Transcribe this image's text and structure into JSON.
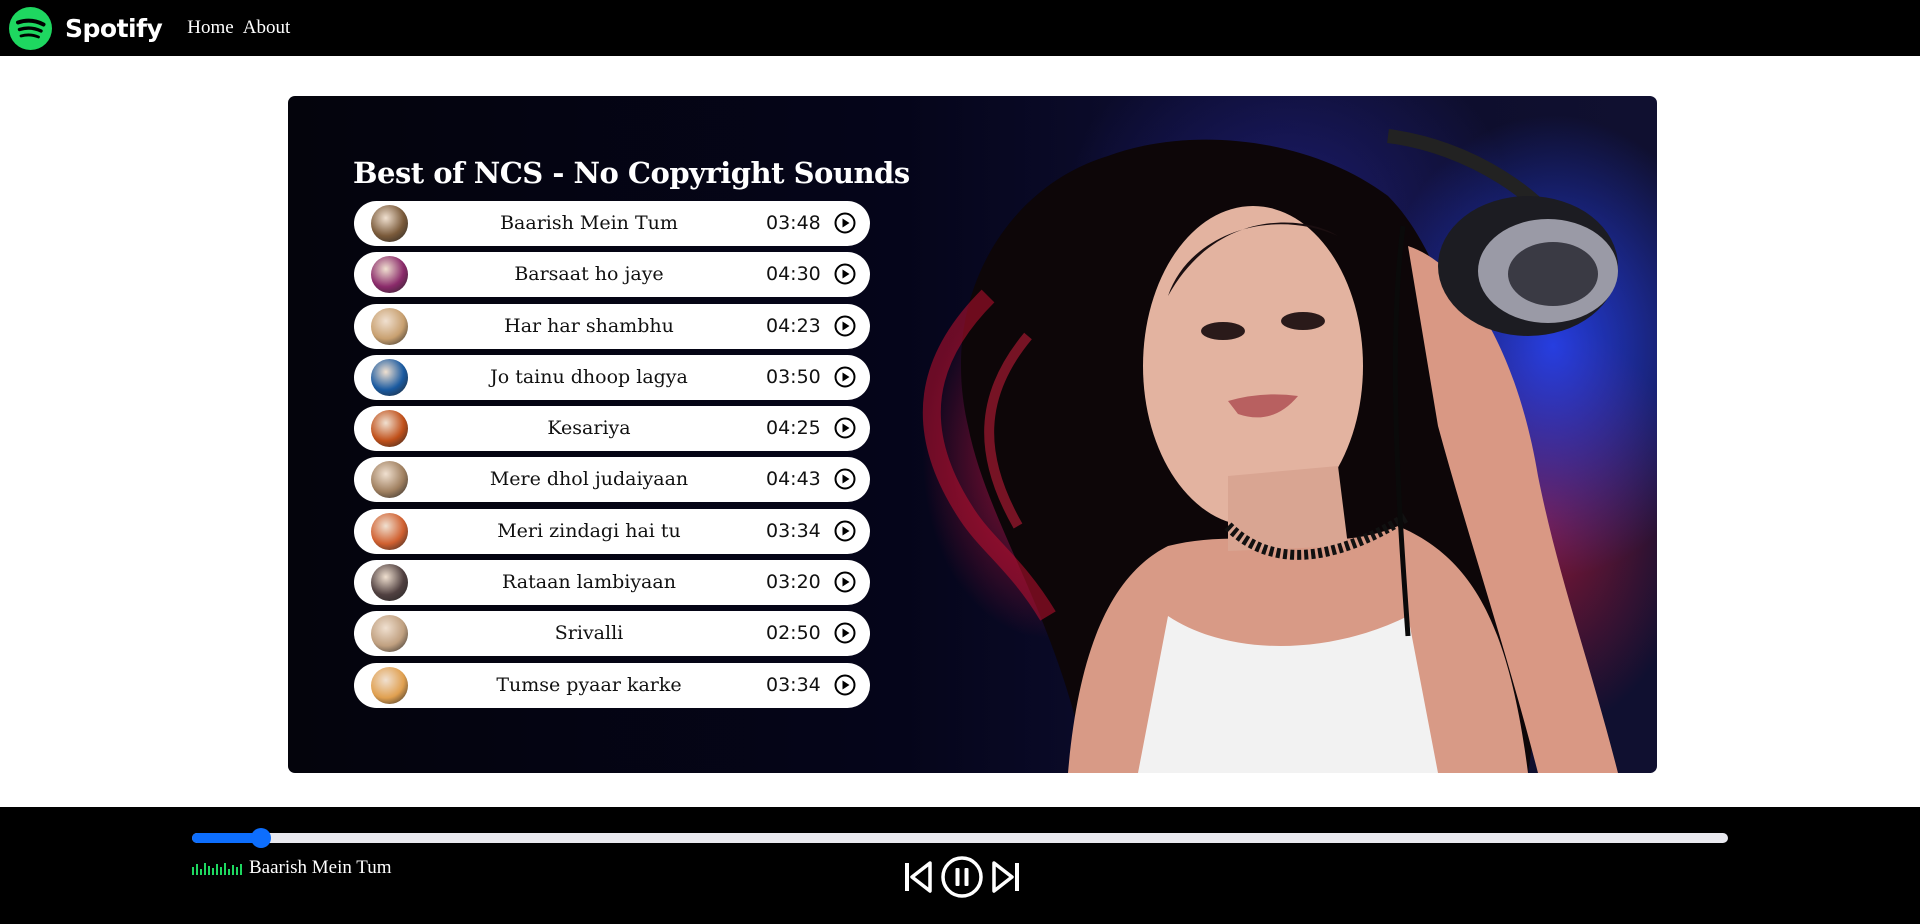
{
  "navbar": {
    "brand": "Spotify",
    "links": [
      "Home",
      "About"
    ]
  },
  "playlist": {
    "title": "Best of NCS - No Copyright Sounds",
    "songs": [
      {
        "name": "Baarish Mein Tum",
        "duration": "03:48",
        "cover_color": "#7a5a3a"
      },
      {
        "name": "Barsaat ho jaye",
        "duration": "04:30",
        "cover_color": "#8a2a6a"
      },
      {
        "name": "Har har shambhu",
        "duration": "04:23",
        "cover_color": "#c8a070"
      },
      {
        "name": "Jo tainu dhoop lagya",
        "duration": "03:50",
        "cover_color": "#1a5aa0"
      },
      {
        "name": "Kesariya",
        "duration": "04:25",
        "cover_color": "#c0501a"
      },
      {
        "name": "Mere dhol judaiyaan",
        "duration": "04:43",
        "cover_color": "#a08060"
      },
      {
        "name": "Meri zindagi hai tu",
        "duration": "03:34",
        "cover_color": "#d06030"
      },
      {
        "name": "Rataan lambiyaan",
        "duration": "03:20",
        "cover_color": "#504040"
      },
      {
        "name": "Srivalli",
        "duration": "02:50",
        "cover_color": "#c0a080"
      },
      {
        "name": "Tumse pyaar karke",
        "duration": "03:34",
        "cover_color": "#e0a050"
      }
    ]
  },
  "player": {
    "now_playing": "Baarish Mein Tum",
    "progress_fraction": 0.045,
    "state": "playing"
  },
  "colors": {
    "brand_green": "#1ed760",
    "accent_blue": "#0d6efd"
  },
  "icons": [
    "spotify-logo-icon",
    "play-circle-icon",
    "equalizer-icon",
    "skip-previous-icon",
    "pause-circle-icon",
    "skip-next-icon"
  ]
}
